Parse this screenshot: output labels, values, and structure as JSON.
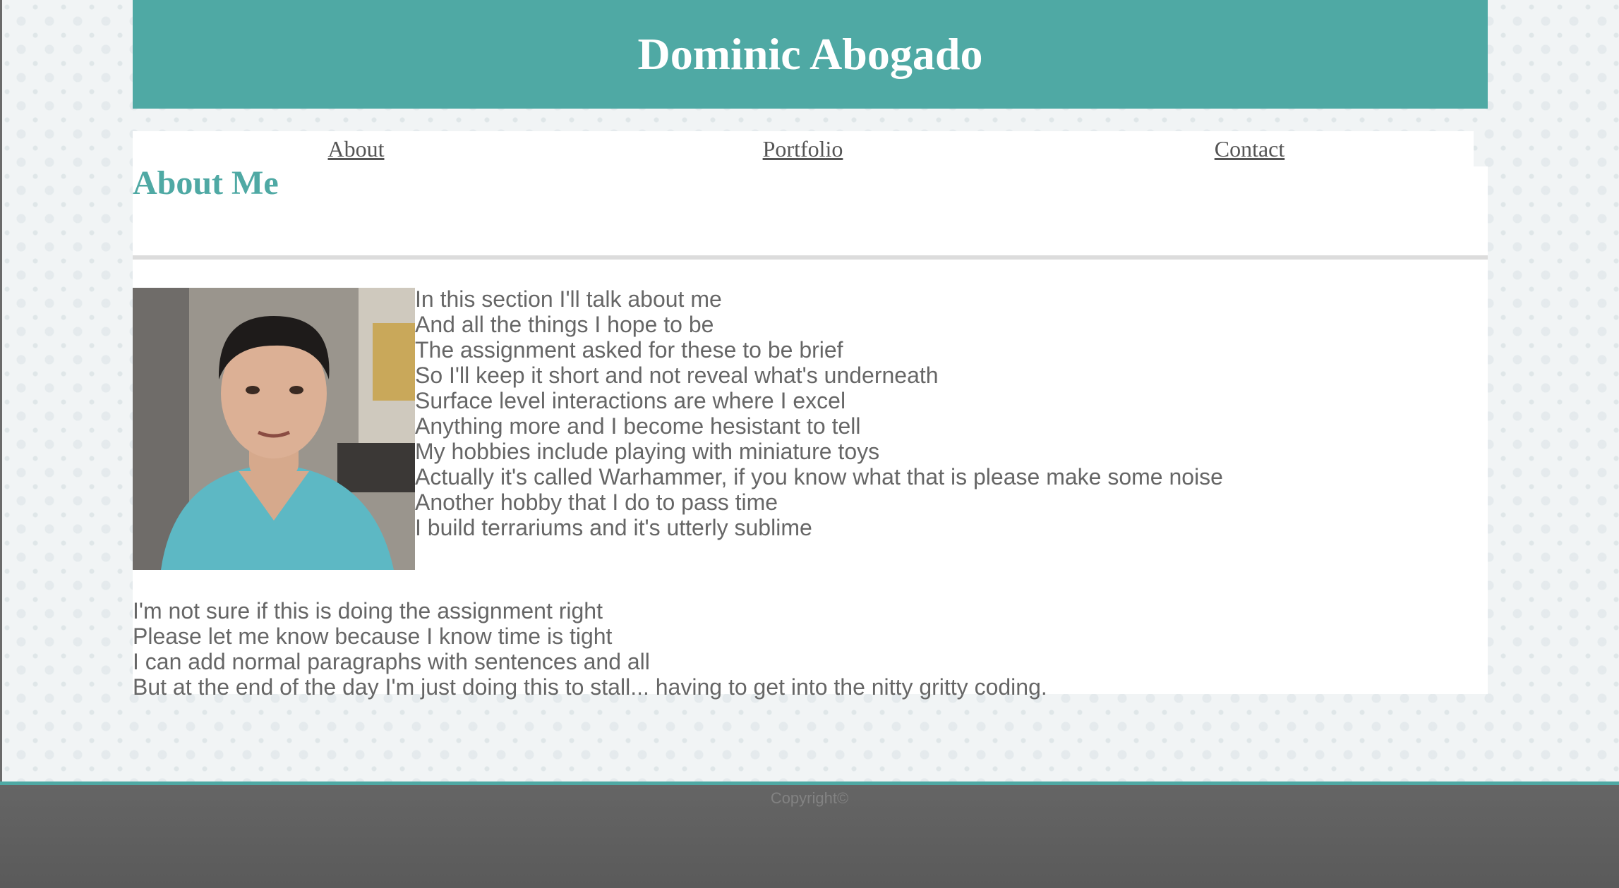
{
  "header": {
    "title": "Dominic Abogado"
  },
  "nav": {
    "items": [
      {
        "label": "About"
      },
      {
        "label": "Portfolio"
      },
      {
        "label": "Contact"
      }
    ]
  },
  "about": {
    "heading": "About Me",
    "photo_icon": "profile-photo",
    "poem_lines": [
      "In this section I'll talk about me",
      "And all the things I hope to be",
      "The assignment asked for these to be brief",
      "So I'll keep it short and not reveal what's underneath",
      "Surface level interactions are where I excel",
      "Anything more and I become hesistant to tell",
      "My hobbies include playing with miniature toys",
      "Actually it's called Warhammer, if you know what that is please make some noise",
      "Another hobby that I do to pass time",
      "I build terrariums and it's utterly sublime"
    ],
    "note_lines": [
      "I'm not sure if this is doing the assignment right",
      "Please let me know because I know time is tight",
      "I can add normal paragraphs with sentences and all",
      "But at the end of the day I'm just doing this to stall... having to get into the nitty gritty coding."
    ]
  },
  "footer": {
    "copyright": "Copyright©"
  },
  "colors": {
    "accent": "#4fa9a4",
    "text": "#666666",
    "footer_bg": "#5f5f5f"
  }
}
